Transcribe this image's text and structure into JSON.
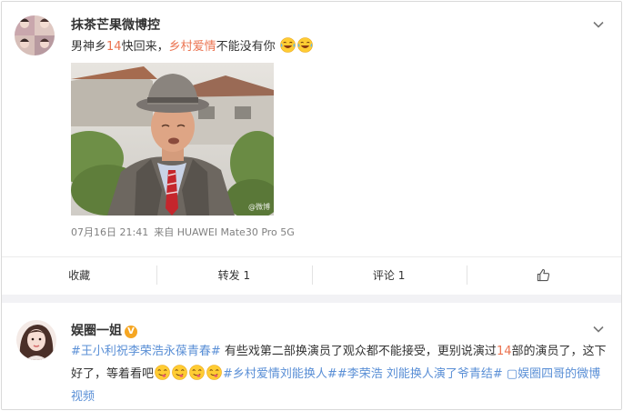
{
  "post1": {
    "username": "抹茶芒果微博控",
    "text_a": "男神乡",
    "text_num": "14",
    "text_b": "快回来，",
    "text_hl": "乡村爱情",
    "text_c": "不能没有你",
    "emoji": "laughing-crying",
    "photo_watermark": "@微博",
    "date": "07月16日 21:41",
    "source": "来自 HUAWEI Mate30 Pro 5G",
    "actions": {
      "collect_label": "收藏",
      "repost_label": "转发 1",
      "comment_label": "评论 1",
      "like_icon": "thumb-up-icon"
    }
  },
  "post2": {
    "username": "娱圈一姐",
    "verified": "V",
    "tag1": "#王小利祝李荣浩永葆青春#",
    "text_a": " 有些戏第二部换演员了观众都不能接受，更别说演过",
    "text_num": "14",
    "text_b": "部的演员了，这下好了，等着看吧",
    "tag2": "#乡村爱情刘能换人#",
    "tag3": "#李荣浩 刘能换人演了爷青结#",
    "video_link": " ▢娱圈四哥的微博视频"
  },
  "colors": {
    "highlight": "#eb7350",
    "link_blue": "#5a8fd6",
    "meta_gray": "#808080",
    "background": "#f2f2f5"
  }
}
